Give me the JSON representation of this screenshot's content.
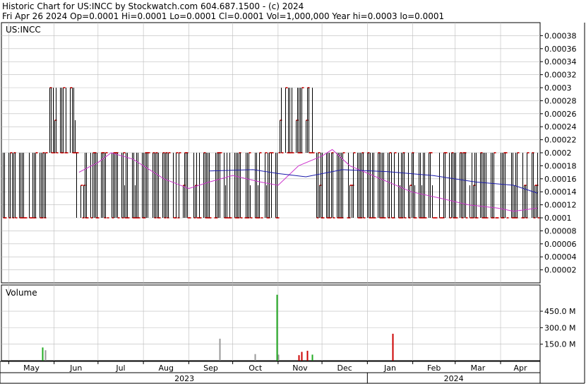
{
  "header": {
    "title_line": "Historic Chart for US:INCC by Stockwatch.com 604.687.1500 - (c) 2024",
    "stats_line": "Fri Apr 26 2024  Op=0.0001  Hi=0.0001  Lo=0.0001  Cl=0.0001  Vol=1,000,000  Year hi=0.0003  lo=0.0001"
  },
  "colors": {
    "price_bar": "#000000",
    "close_tick": "#cc0000",
    "ma_short": "#cc33cc",
    "ma_long": "#1a1aaa",
    "volume_up": "#22aa22",
    "volume_down": "#cc0000",
    "volume_flat": "#999999",
    "grid": "#bbbbbb"
  },
  "chart_data": [
    {
      "type": "ohlc",
      "label": "US:INCC",
      "ylim": [
        0,
        0.0004
      ],
      "y_ticks": [
        "0.00038",
        "0.00036",
        "0.00034",
        "0.00032",
        "0.0003",
        "0.00028",
        "0.00026",
        "0.00024",
        "0.00022",
        "0.0002",
        "0.00018",
        "0.00016",
        "0.00014",
        "0.00012",
        "0.0001",
        "0.00008",
        "0.00006",
        "0.00004",
        "0.00002"
      ],
      "x_months": [
        "May",
        "Jun",
        "Jul",
        "Aug",
        "Sep",
        "Oct",
        "Nov",
        "Dec",
        "Jan",
        "Feb",
        "Mar",
        "Apr"
      ],
      "x_years": [
        "2023",
        "2024"
      ],
      "grid": true,
      "price_levels": [
        0.0001,
        0.00015,
        0.0002,
        0.00025,
        0.0003
      ],
      "segments": [
        {
          "from": "2023-04-27",
          "to": "2023-05-26",
          "lo": 0.0001,
          "hi": 0.0002
        },
        {
          "from": "2023-05-29",
          "to": "2023-06-15",
          "lo": 0.0002,
          "hi": 0.0003
        },
        {
          "from": "2023-06-16",
          "to": "2023-09-22",
          "lo": 0.0001,
          "hi": 0.0002
        },
        {
          "from": "2023-09-25",
          "to": "2023-10-31",
          "lo": 0.0001,
          "hi": 0.0002
        },
        {
          "from": "2023-11-01",
          "to": "2023-11-24",
          "lo": 0.0002,
          "hi": 0.0003
        },
        {
          "from": "2023-11-27",
          "to": "2024-01-31",
          "lo": 0.0001,
          "hi": 0.0002
        },
        {
          "from": "2024-02-01",
          "to": "2024-04-26",
          "lo": 0.0001,
          "hi": 0.0002
        }
      ],
      "ma_short_series": [
        [
          "2023-06-18",
          0.00017
        ],
        [
          "2023-07-01",
          0.000185
        ],
        [
          "2023-07-10",
          0.0002
        ],
        [
          "2023-07-25",
          0.00019
        ],
        [
          "2023-08-15",
          0.00016
        ],
        [
          "2023-09-01",
          0.000145
        ],
        [
          "2023-09-15",
          0.000155
        ],
        [
          "2023-10-01",
          0.000165
        ],
        [
          "2023-10-20",
          0.000155
        ],
        [
          "2023-11-01",
          0.00015
        ],
        [
          "2023-11-15",
          0.00018
        ],
        [
          "2023-12-01",
          0.000195
        ],
        [
          "2023-12-08",
          0.000205
        ],
        [
          "2023-12-20",
          0.00018
        ],
        [
          "2024-01-10",
          0.00016
        ],
        [
          "2024-01-31",
          0.00014
        ],
        [
          "2024-02-20",
          0.00013
        ],
        [
          "2024-03-10",
          0.00012
        ],
        [
          "2024-03-30",
          0.000115
        ],
        [
          "2024-04-10",
          0.00011
        ],
        [
          "2024-04-26",
          0.000115
        ]
      ],
      "ma_long_series": [
        [
          "2023-09-15",
          0.000172
        ],
        [
          "2023-10-15",
          0.000174
        ],
        [
          "2023-11-01",
          0.000168
        ],
        [
          "2023-11-20",
          0.000163
        ],
        [
          "2023-12-15",
          0.000174
        ],
        [
          "2024-01-15",
          0.000171
        ],
        [
          "2024-02-15",
          0.000165
        ],
        [
          "2024-03-15",
          0.000155
        ],
        [
          "2024-04-10",
          0.00015
        ],
        [
          "2024-04-26",
          0.000138
        ]
      ]
    },
    {
      "type": "bar",
      "label": "Volume",
      "ylim": [
        0,
        650
      ],
      "y_unit": "M",
      "y_ticks": [
        "450.0 M",
        "300.0 M",
        "150.0 M"
      ],
      "bars": [
        {
          "date": "2023-05-24",
          "value_m": 120,
          "color": "up"
        },
        {
          "date": "2023-05-26",
          "value_m": 95,
          "color": "flat"
        },
        {
          "date": "2023-09-22",
          "value_m": 200,
          "color": "flat"
        },
        {
          "date": "2023-10-16",
          "value_m": 60,
          "color": "flat"
        },
        {
          "date": "2023-10-31",
          "value_m": 600,
          "color": "up"
        },
        {
          "date": "2023-11-01",
          "value_m": 55,
          "color": "flat"
        },
        {
          "date": "2023-11-15",
          "value_m": 50,
          "color": "down"
        },
        {
          "date": "2023-11-17",
          "value_m": 80,
          "color": "down"
        },
        {
          "date": "2023-11-21",
          "value_m": 90,
          "color": "down"
        },
        {
          "date": "2023-11-24",
          "value_m": 55,
          "color": "up"
        },
        {
          "date": "2024-01-18",
          "value_m": 245,
          "color": "down"
        }
      ]
    }
  ]
}
